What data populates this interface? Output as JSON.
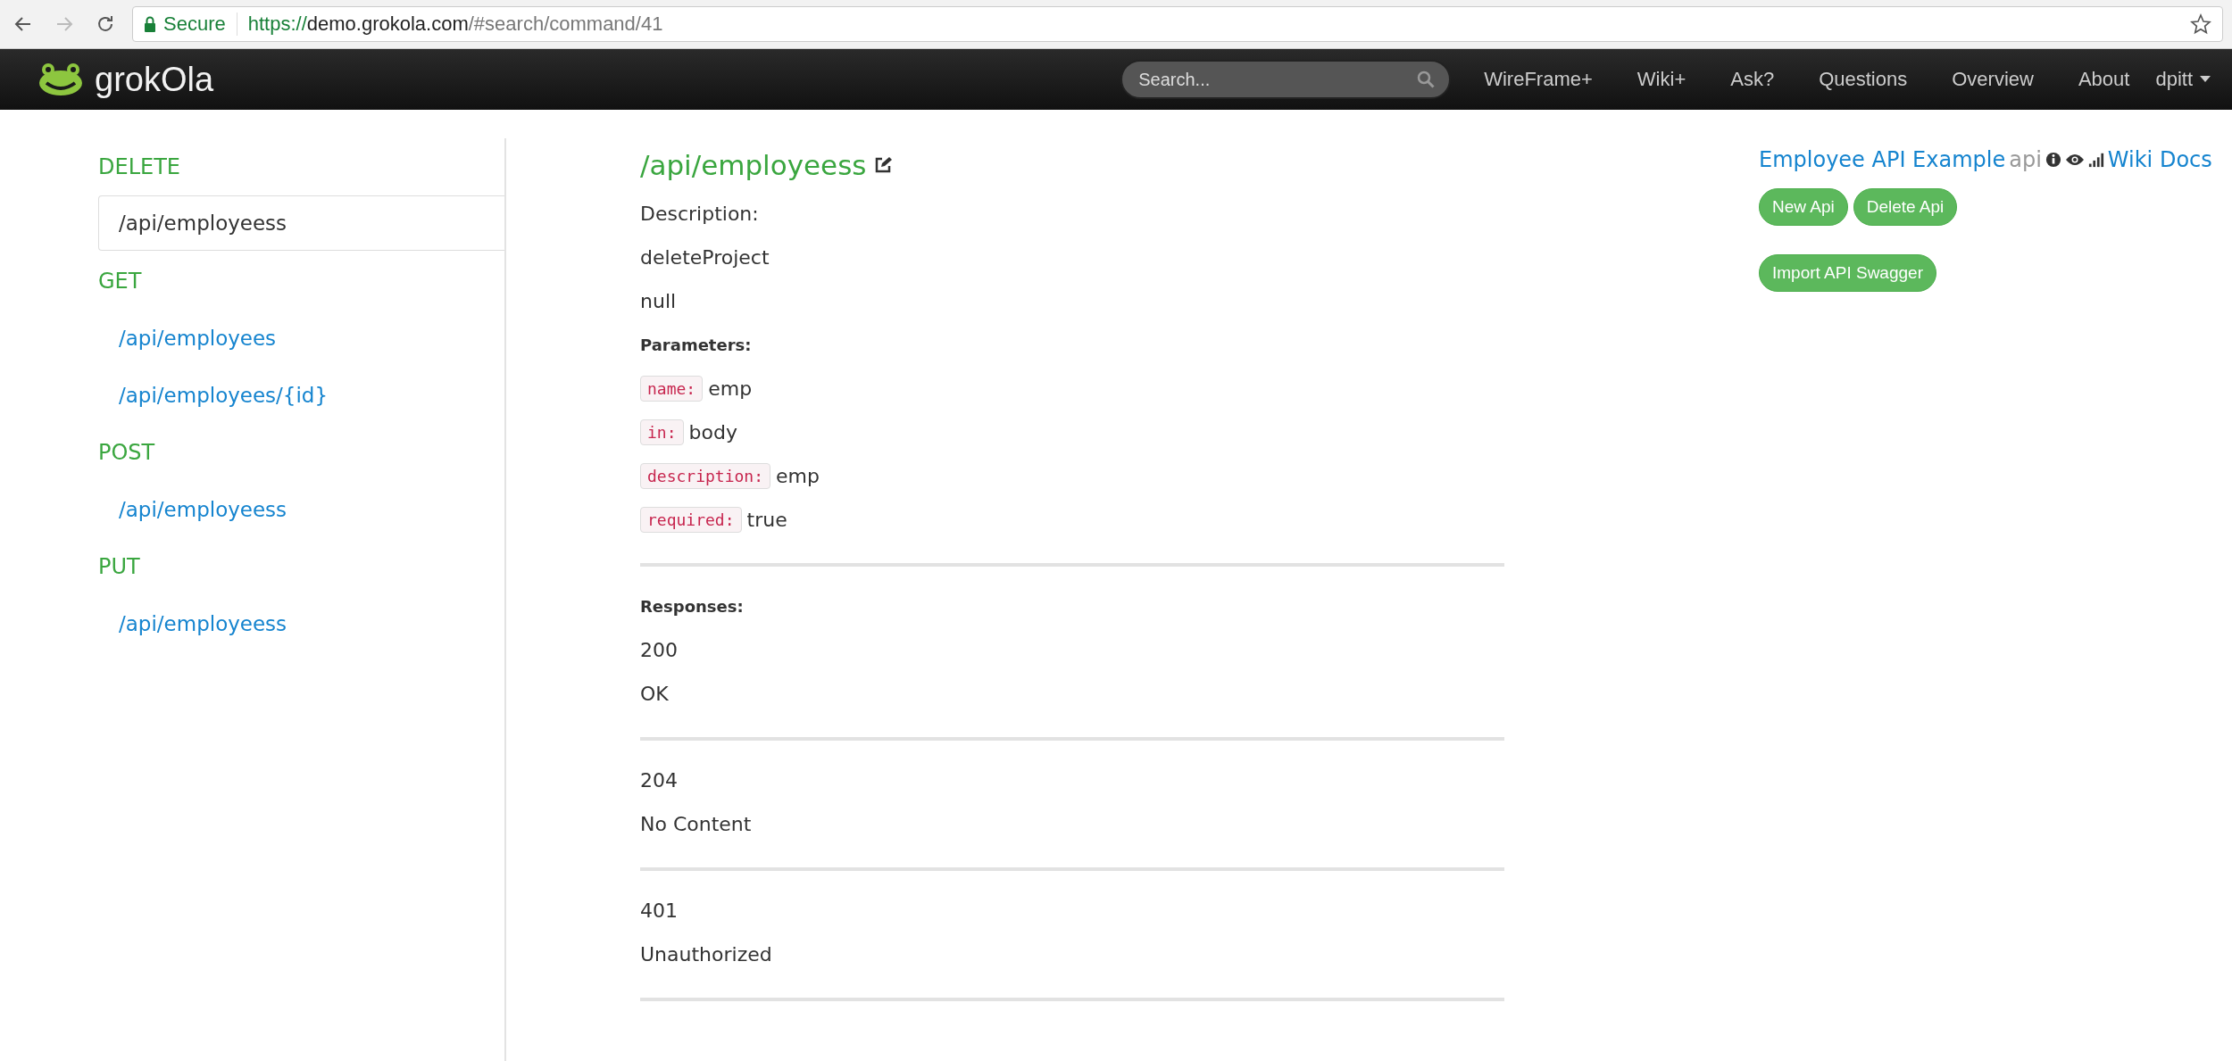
{
  "browser": {
    "secure_label": "Secure",
    "url_scheme": "https://",
    "url_host": "demo.grokola.com",
    "url_path": "/#search/command/41"
  },
  "navbar": {
    "logo": "grokOla",
    "search": {
      "placeholder": "Search..."
    },
    "links": [
      "WireFrame+",
      "Wiki+",
      "Ask?",
      "Questions",
      "Overview",
      "About"
    ],
    "user": "dpitt"
  },
  "sidebar": {
    "groups": [
      {
        "method": "DELETE",
        "items": [
          {
            "label": "/api/employeess",
            "selected": true
          }
        ]
      },
      {
        "method": "GET",
        "items": [
          {
            "label": "/api/employees",
            "selected": false
          },
          {
            "label": "/api/employees/{id}",
            "selected": false
          }
        ]
      },
      {
        "method": "POST",
        "items": [
          {
            "label": "/api/employeess",
            "selected": false
          }
        ]
      },
      {
        "method": "PUT",
        "items": [
          {
            "label": "/api/employeess",
            "selected": false
          }
        ]
      }
    ]
  },
  "endpoint": {
    "title": "/api/employeess",
    "description_label": "Description:",
    "description": [
      "deleteProject",
      "null"
    ],
    "parameters_label": "Parameters:",
    "parameters": [
      {
        "key": "name:",
        "value": "emp"
      },
      {
        "key": "in:",
        "value": "body"
      },
      {
        "key": "description:",
        "value": "emp"
      },
      {
        "key": "required:",
        "value": "true"
      }
    ],
    "responses_label": "Responses:",
    "responses": [
      {
        "code": "200",
        "message": "OK"
      },
      {
        "code": "204",
        "message": "No Content"
      },
      {
        "code": "401",
        "message": "Unauthorized"
      }
    ]
  },
  "project": {
    "name": "Employee API Example",
    "tag": "api",
    "wiki": "Wiki Docs",
    "buttons": [
      "New Api",
      "Delete Api"
    ],
    "import_button": "Import API Swagger"
  }
}
